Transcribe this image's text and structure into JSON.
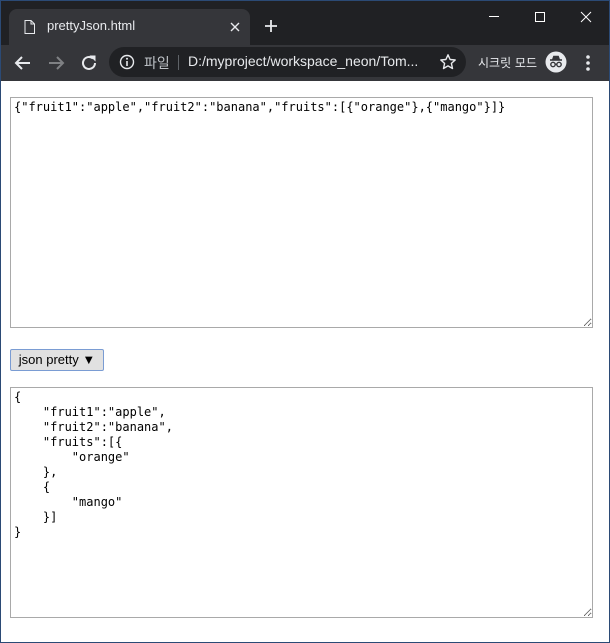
{
  "browser": {
    "tab_title": "prettyJson.html",
    "omnibox": {
      "scheme_label": "파일",
      "url": "D:/myproject/workspace_neon/Tom..."
    },
    "incognito_label": "시크릿 모드",
    "icons": [
      "page-icon",
      "close-icon",
      "plus-icon",
      "minimize-icon",
      "maximize-icon",
      "window-close-icon",
      "back-arrow-icon",
      "forward-arrow-icon",
      "reload-icon",
      "info-icon",
      "star-icon",
      "incognito-icon",
      "more-vert-icon"
    ],
    "colors": {
      "frame": "#202124",
      "toolbar": "#35363a",
      "omnibox": "#202124"
    }
  },
  "page": {
    "input_json": "{\"fruit1\":\"apple\",\"fruit2\":\"banana\",\"fruits\":[{\"orange\"},{\"mango\"}]}",
    "pretty_button_label": "json pretty ▼",
    "output_json": "{\n    \"fruit1\":\"apple\",\n    \"fruit2\":\"banana\",\n    \"fruits\":[{\n        \"orange\"\n    },\n    {\n        \"mango\"\n    }]\n}"
  }
}
